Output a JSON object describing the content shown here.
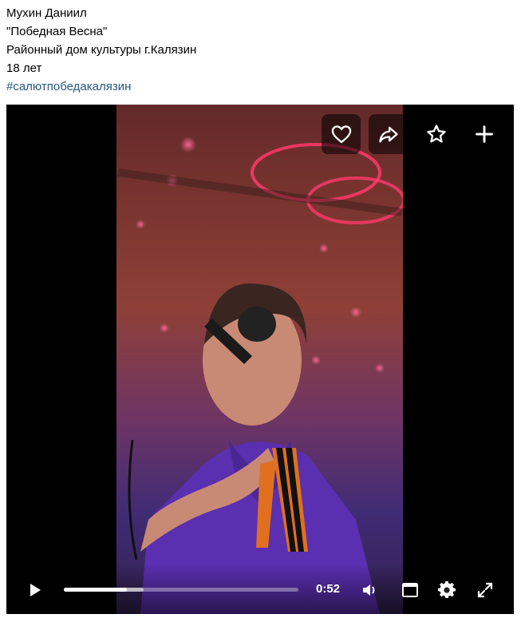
{
  "post": {
    "author_line": "Мухин Даниил",
    "title_line": "\"Победная Весна\"",
    "venue_line": "Районный дом культуры г.Калязин",
    "age_line": "18 лет",
    "hashtag": "#салютпобедакалязин"
  },
  "player": {
    "top_actions": [
      {
        "name": "like-button",
        "icon": "heart-icon"
      },
      {
        "name": "share-button",
        "icon": "share-arrow-icon"
      },
      {
        "name": "favorite-button",
        "icon": "star-icon"
      },
      {
        "name": "add-button",
        "icon": "plus-icon"
      }
    ],
    "time_display": "0:52",
    "progress": {
      "played_fraction": 0.27,
      "buffered_fraction": 0.34
    },
    "controls": [
      "play-icon",
      "volume-icon",
      "miniplayer-icon",
      "settings-gear-icon",
      "fullscreen-icon"
    ]
  },
  "colors": {
    "hashtag": "#2a5885",
    "player_bg": "#000000",
    "button_bg": "rgba(0,0,0,0.55)"
  }
}
